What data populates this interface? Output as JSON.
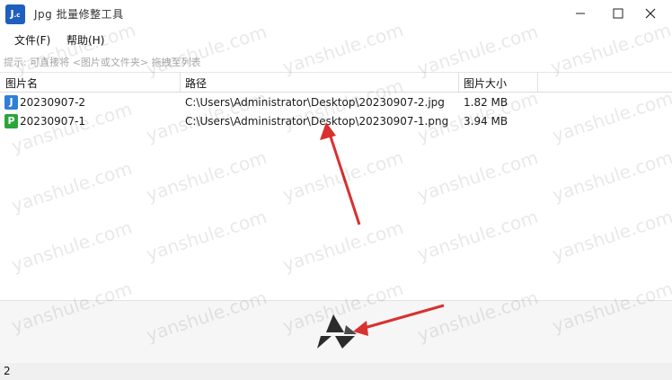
{
  "titlebar": {
    "title": "Jpg 批量修整工具",
    "app_icon_text": "J",
    "app_icon_sub": ".c"
  },
  "menu": {
    "file": "文件(F)",
    "help": "帮助(H)"
  },
  "hint": "提示: 可直接将 <图片或文件夹> 拖拽至列表",
  "table": {
    "columns": [
      "图片名",
      "路径",
      "图片大小"
    ],
    "rows": [
      {
        "icon": "J",
        "icon_type": "jpg-file-icon",
        "name": "20230907-2",
        "path": "C:\\Users\\Administrator\\Desktop\\20230907-2.jpg",
        "size": "1.82 MB"
      },
      {
        "icon": "P",
        "icon_type": "png-file-icon",
        "name": "20230907-1",
        "path": "C:\\Users\\Administrator\\Desktop\\20230907-1.png",
        "size": "3.94 MB"
      }
    ]
  },
  "status": {
    "count": "2"
  },
  "watermark": "yanshule.com",
  "colors": {
    "app_icon": "#1f5fbf",
    "jpg_icon": "#2f7fd8",
    "png_icon": "#2aa53a",
    "annotation_arrow": "#d93030"
  }
}
